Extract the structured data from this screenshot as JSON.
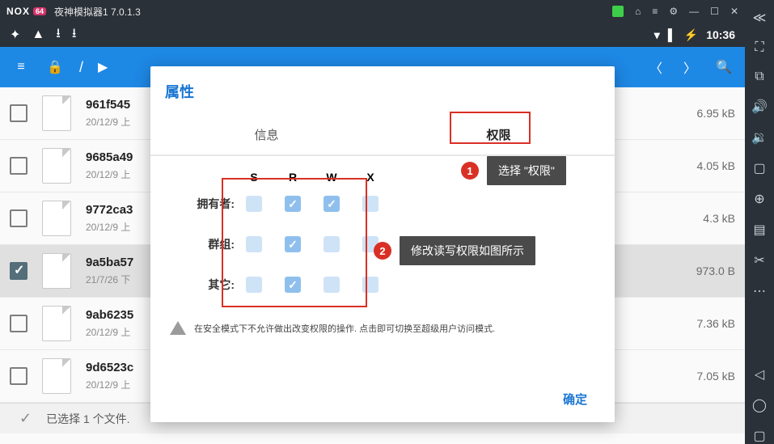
{
  "titlebar": {
    "brand": "NOX",
    "badge": "64",
    "title": "夜神模拟器1 7.0.1.3"
  },
  "status": {
    "time": "10:36"
  },
  "dialog": {
    "title": "属性",
    "tabs": {
      "info": "信息",
      "perm": "权限"
    },
    "columns": [
      "S",
      "R",
      "W",
      "X"
    ],
    "rows": {
      "owner": "拥有者:",
      "group": "群组:",
      "other": "其它:"
    },
    "perm": {
      "owner": [
        false,
        true,
        true,
        false
      ],
      "group": [
        false,
        true,
        false,
        false
      ],
      "other": [
        false,
        true,
        false,
        false
      ]
    },
    "warning": "在安全模式下不允许做出改变权限的操作. 点击即可切换至超级用户访问模式.",
    "ok": "确定"
  },
  "callouts": {
    "c1": "选择 \"权限\"",
    "c2": "修改读写权限如图所示"
  },
  "files": [
    {
      "name": "961f545",
      "meta": "20/12/9 上",
      "size": "6.95 kB",
      "selected": false
    },
    {
      "name": "9685a49",
      "meta": "20/12/9 上",
      "size": "4.05 kB",
      "selected": false
    },
    {
      "name": "9772ca3",
      "meta": "20/12/9 上",
      "size": "4.3 kB",
      "selected": false
    },
    {
      "name": "9a5ba57",
      "meta": "21/7/26 下",
      "size": "973.0 B",
      "selected": true
    },
    {
      "name": "9ab6235",
      "meta": "20/12/9 上",
      "size": "7.36 kB",
      "selected": false
    },
    {
      "name": "9d6523c",
      "meta": "20/12/9 上",
      "size": "7.05 kB",
      "selected": false
    }
  ],
  "statusbar": "已选择 1 个文件."
}
